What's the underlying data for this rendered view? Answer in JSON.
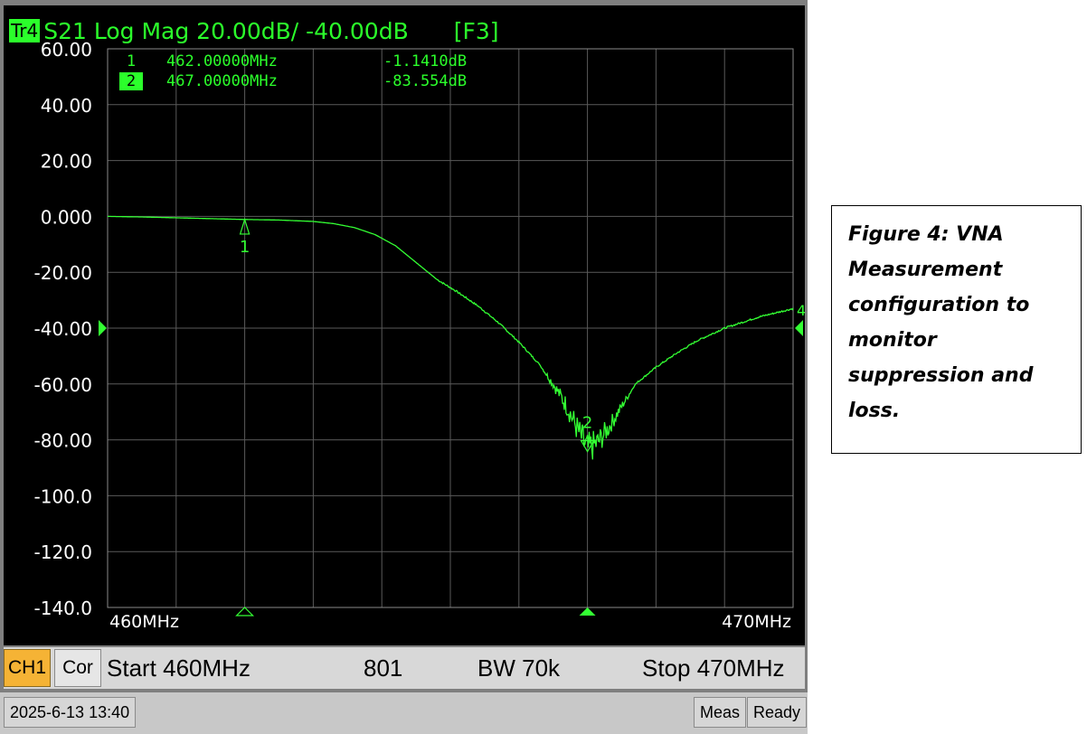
{
  "header": {
    "badge": "Tr4",
    "measurement": "S21 Log Mag 20.00dB/ -40.00dB",
    "function_key": "[F3]"
  },
  "markers": [
    {
      "number": "1",
      "frequency": "462.00000MHz",
      "value": "-1.1410dB",
      "active": false
    },
    {
      "number": "2",
      "frequency": "467.00000MHz",
      "value": "-83.554dB",
      "active": true
    }
  ],
  "chart_data": {
    "type": "line",
    "xlim": [
      460,
      470
    ],
    "ylim": [
      -140,
      60
    ],
    "x_unit": "MHz",
    "y_unit": "dB",
    "y_ticks": [
      "60.00",
      "40.00",
      "20.00",
      "0.000",
      "-20.00",
      "-40.00",
      "-60.00",
      "-80.00",
      "-100.0",
      "-120.0",
      "-140.0"
    ],
    "y_tick_values": [
      60,
      40,
      20,
      0,
      -20,
      -40,
      -60,
      -80,
      -100,
      -120,
      -140
    ],
    "x_tick_labels": {
      "start": "460MHz",
      "stop": "470MHz"
    },
    "reference_level": -40,
    "reference_label": "4",
    "grid": true,
    "series": [
      {
        "color": "#33ff33",
        "x": [
          460.0,
          460.5,
          461.0,
          461.5,
          462.0,
          462.5,
          463.0,
          463.3,
          463.6,
          463.9,
          464.2,
          464.5,
          464.8,
          465.1,
          465.4,
          465.7,
          466.0,
          466.3,
          466.5,
          466.7,
          466.85,
          467.0,
          467.15,
          467.3,
          467.5,
          467.7,
          468.0,
          468.3,
          468.6,
          469.0,
          469.5,
          470.0
        ],
        "y": [
          0.0,
          -0.2,
          -0.5,
          -0.8,
          -1.1,
          -1.3,
          -1.8,
          -2.6,
          -4.0,
          -6.5,
          -10.5,
          -16.5,
          -22.5,
          -27.0,
          -32.0,
          -38.0,
          -45.0,
          -53.0,
          -60.0,
          -68.0,
          -76.0,
          -83.5,
          -81.0,
          -76.0,
          -68.0,
          -60.0,
          -54.0,
          -49.0,
          -44.5,
          -40.0,
          -36.0,
          -33.0
        ]
      }
    ],
    "markers": [
      {
        "label": "1",
        "x": 462.0,
        "y": -1.141
      },
      {
        "label": "2",
        "x": 467.0,
        "y": -83.554
      }
    ]
  },
  "status": {
    "channel": "CH1",
    "correction": "Cor",
    "start": "Start 460MHz",
    "points": "801",
    "bandwidth": "BW 70k",
    "stop": "Stop 470MHz"
  },
  "footer": {
    "datetime": "2025-6-13 13:40",
    "meas": "Meas",
    "ready": "Ready"
  },
  "caption": "Figure 4: VNA Measurement configuration to monitor suppression and loss."
}
